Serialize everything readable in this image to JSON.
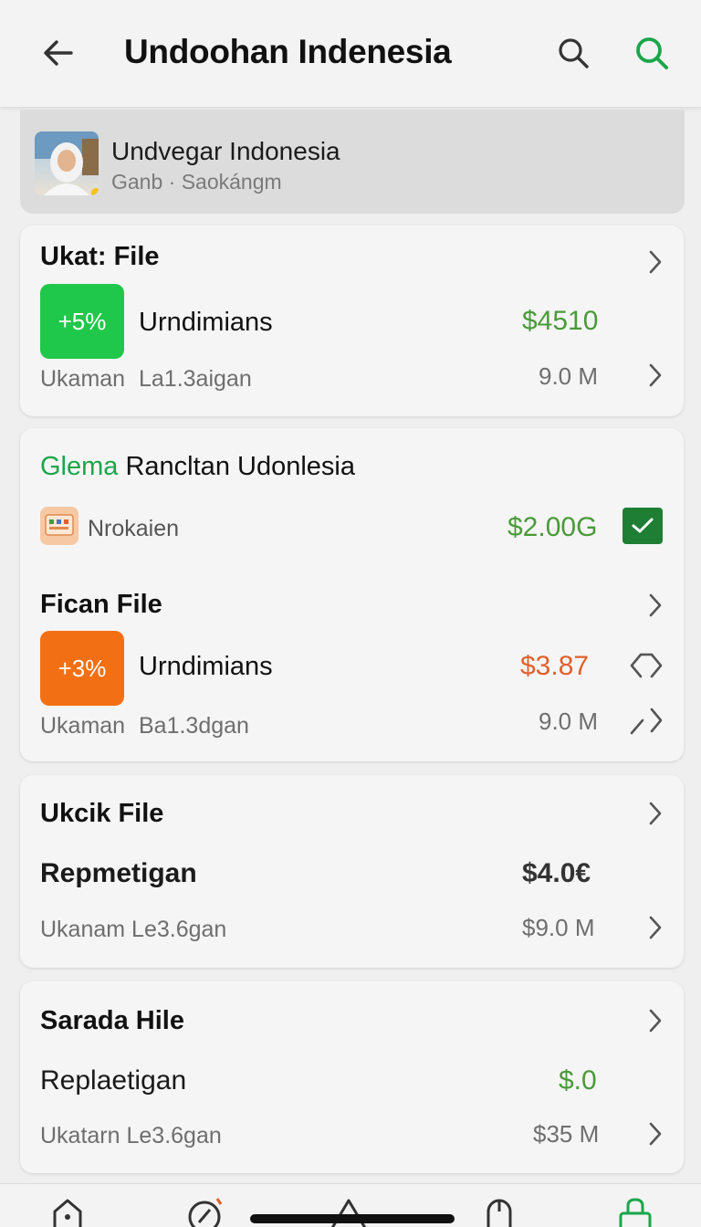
{
  "header": {
    "title": "Undoohan Indenesia"
  },
  "profile": {
    "name": "Undvegar Indonesia",
    "subtitle": "Ganb · Saokángm"
  },
  "card1": {
    "title": "Ukat: File",
    "tile_text": "+5%",
    "tile_color": "#1fc84a",
    "item": "Urndimians",
    "price": "$4510",
    "price_color": "#4a9a3a",
    "left_sub": "Ukaman",
    "mid_sub": "La1.3aigan",
    "size": "9.0 M"
  },
  "card2": {
    "title_green": "Glema",
    "title_rest": "Rancltan Udonlesia",
    "row_label": "Nrokaien",
    "row_price": "$2.00G",
    "section_title": "Fican File",
    "tile_text": "+3%",
    "tile_color": "#f36f14",
    "item": "Urndimians",
    "price": "$3.87",
    "price_color": "#e0602c",
    "left_sub": "Ukaman",
    "mid_sub": "Ba1.3dgan",
    "size": "9.0 M"
  },
  "card3": {
    "title": "Ukcik File",
    "item": "Repmetigan",
    "price": "$4.0€",
    "sub": "Ukanam Le3.6gan",
    "size": "$9.0 M"
  },
  "card4": {
    "title": "Sarada Hile",
    "item": "Replaetigan",
    "price": "$.0",
    "sub": "Ukatarn Le3.6gan",
    "size": "$35 M"
  },
  "colors": {
    "accent_green": "#1aa64a",
    "price_green": "#4a9a3a",
    "price_orange": "#e0602c"
  },
  "icons": [
    "back-arrow-icon",
    "search-icon",
    "search-green-icon",
    "chevron-right-icon",
    "check-box-icon",
    "swap-icon",
    "home-icon",
    "compass-icon",
    "mouse-icon",
    "lock-icon"
  ]
}
